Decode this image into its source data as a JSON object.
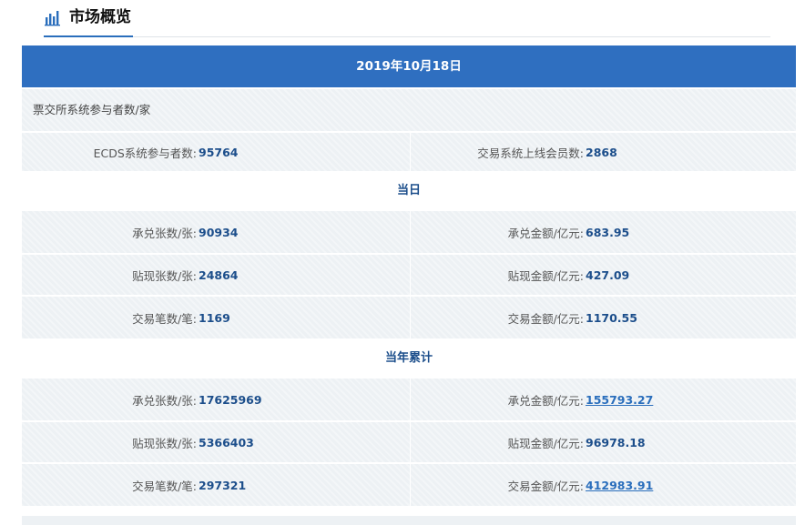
{
  "header": {
    "title": "市场概览",
    "icon": "bar-chart-icon"
  },
  "date": "2019年10月18日",
  "participants": {
    "label": "票交所系统参与者数/家",
    "ecds_label": "ECDS系统参与者数:",
    "ecds_value": "95764",
    "member_label": "交易系统上线会员数:",
    "member_value": "2868"
  },
  "today": {
    "title": "当日",
    "rows": [
      {
        "left_label": "承兑张数/张:",
        "left_value": "90934",
        "right_label": "承兑金额/亿元:",
        "right_value": "683.95"
      },
      {
        "left_label": "贴现张数/张:",
        "left_value": "24864",
        "right_label": "贴现金额/亿元:",
        "right_value": "427.09"
      },
      {
        "left_label": "交易笔数/笔:",
        "left_value": "1169",
        "right_label": "交易金额/亿元:",
        "right_value": "1170.55"
      }
    ]
  },
  "ytd": {
    "title": "当年累计",
    "rows": [
      {
        "left_label": "承兑张数/张:",
        "left_value": "17625969",
        "right_label": "承兑金额/亿元:",
        "right_value": "155793.27"
      },
      {
        "left_label": "贴现张数/张:",
        "left_value": "5366403",
        "right_label": "贴现金额/亿元:",
        "right_value": "96978.18"
      },
      {
        "left_label": "交易笔数/笔:",
        "left_value": "297321",
        "right_label": "交易金额/亿元:",
        "right_value": "412983.91"
      }
    ]
  },
  "colors": {
    "accent": "#2f6fc0",
    "value": "#1c4e8b",
    "row_bg": "#edf1f4"
  }
}
